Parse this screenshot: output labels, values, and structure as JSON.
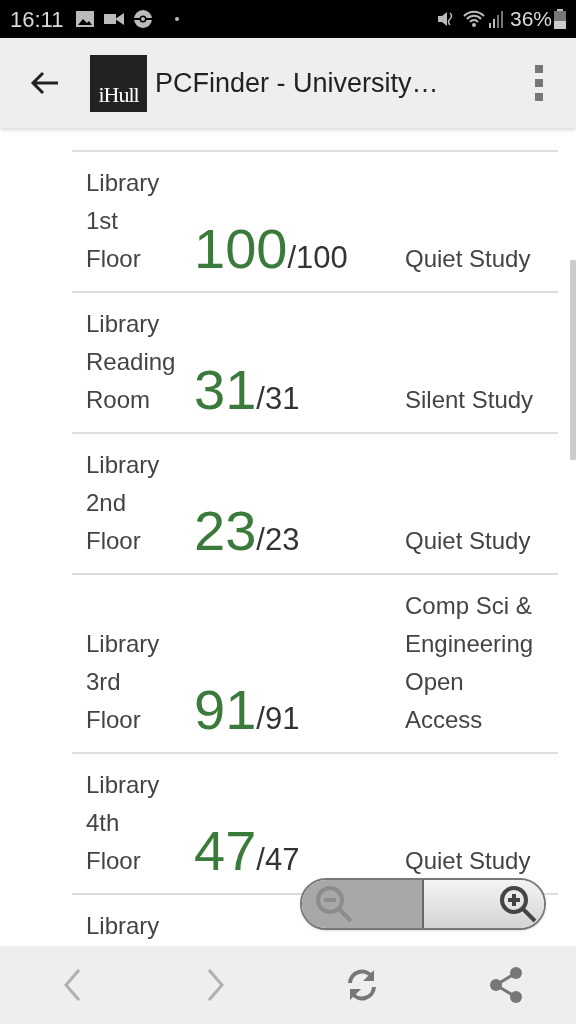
{
  "status_bar": {
    "time": "16:11",
    "battery": "36%"
  },
  "toolbar": {
    "logo": "iHull",
    "title": "PCFinder - University…"
  },
  "rows": [
    {
      "name": "Library 1st Floor",
      "available": "100",
      "total": "/100",
      "type": "Quiet Study"
    },
    {
      "name": "Library Reading Room",
      "available": "31",
      "total": "/31",
      "type": "Silent Study"
    },
    {
      "name": "Library 2nd Floor",
      "available": "23",
      "total": "/23",
      "type": "Quiet Study"
    },
    {
      "name": "Library 3rd Floor",
      "available": "91",
      "total": "/91",
      "type": "Comp Sci & Engineering Open Access"
    },
    {
      "name": "Library 4th Floor",
      "available": "47",
      "total": "/47",
      "type": "Quiet Study"
    },
    {
      "name": "Library"
    }
  ],
  "zoom": {
    "zoom_out_disabled": true,
    "zoom_in_disabled": false
  },
  "nav": {
    "back_disabled": true,
    "forward_disabled": true
  }
}
